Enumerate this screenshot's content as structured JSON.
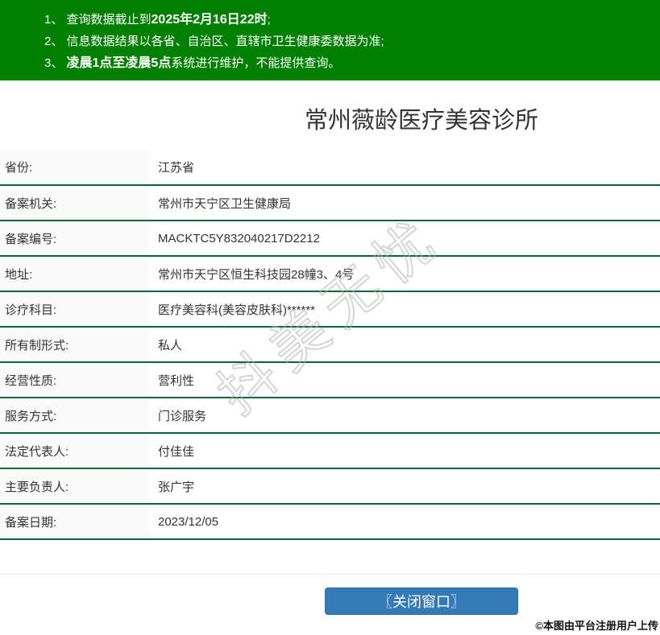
{
  "page": {
    "title": "常州薇龄医疗美容诊所"
  },
  "notice_banner": {
    "items": [
      {
        "segments": [
          {
            "text": "1、 查询数据截止到",
            "bold": false
          },
          {
            "text": "2025年2月16日22时",
            "bold": true
          },
          {
            "text": ";",
            "bold": false
          }
        ]
      },
      {
        "segments": [
          {
            "text": "2、 信息数据结果以各省、自治区、直辖市卫生健康委数据为准;",
            "bold": false
          }
        ]
      },
      {
        "segments": [
          {
            "text": "3、 ",
            "bold": false
          },
          {
            "text": "凌晨1点至凌晨5点",
            "bold": true
          },
          {
            "text": "系统进行维护，不能提供查询。",
            "bold": false
          }
        ]
      }
    ]
  },
  "info_table": {
    "rows": [
      {
        "label": "省份:",
        "value": "江苏省"
      },
      {
        "label": "备案机关:",
        "value": "常州市天宁区卫生健康局"
      },
      {
        "label": "备案编号:",
        "value": "MACKTC5Y832040217D2212"
      },
      {
        "label": "地址:",
        "value": "常州市天宁区恒生科技园28幢3、4号"
      },
      {
        "label": "诊疗科目:",
        "value": "医疗美容科(美容皮肤科)******"
      },
      {
        "label": "所有制形式:",
        "value": "私人"
      },
      {
        "label": "经营性质:",
        "value": "营利性"
      },
      {
        "label": "服务方式:",
        "value": "门诊服务"
      },
      {
        "label": "法定代表人:",
        "value": "付佳佳"
      },
      {
        "label": "主要负责人:",
        "value": "张广宇"
      },
      {
        "label": "备案日期:",
        "value": "2023/12/05"
      }
    ]
  },
  "footer": {
    "close_button_label": "〖关闭窗口〗"
  },
  "watermarks": {
    "diagonal_text": "抖美无忧",
    "corner_text": "©本图由平台注册用户上传"
  },
  "colors": {
    "banner_green": "#008000",
    "divider_green": "#006633",
    "label_bg": "#fafafa",
    "button_blue": "#337ab7",
    "text": "#333333"
  }
}
